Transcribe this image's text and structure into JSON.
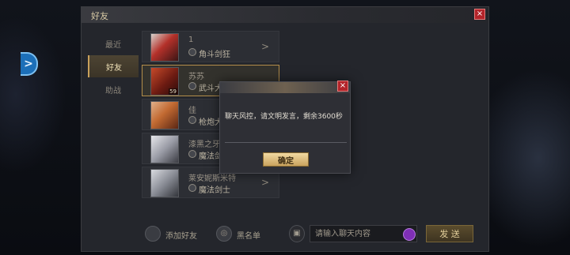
{
  "panel": {
    "title": "好友",
    "close_icon": "×"
  },
  "tabs": [
    {
      "label": "最近",
      "active": false
    },
    {
      "label": "好友",
      "active": true
    },
    {
      "label": "助战",
      "active": false
    }
  ],
  "friends": [
    {
      "name": "1",
      "class": "角斗剑狂",
      "level": ""
    },
    {
      "name": "苏苏",
      "class": "武斗大",
      "level": "59"
    },
    {
      "name": "佳",
      "class": "枪炮大",
      "level": ""
    },
    {
      "name": "漆黑之牙",
      "class": "魔法剑",
      "level": ""
    },
    {
      "name": "莱安妮斯米特",
      "class": "魔法剑士",
      "level": ""
    }
  ],
  "bottom_bar": {
    "add_friend_label": "添加好友",
    "blacklist_label": "黑名单",
    "chat_placeholder": "请输入聊天内容",
    "send_label": "发 送"
  },
  "modal": {
    "message": "聊天风控，请文明发言，剩余3600秒",
    "confirm_label": "确定",
    "close_icon": "×"
  },
  "colors": {
    "accent_gold": "#c9a35e",
    "close_red": "#b3242a",
    "emoji_purple": "#7f2fb5",
    "side_arrow_blue": "#1c6fb8"
  }
}
